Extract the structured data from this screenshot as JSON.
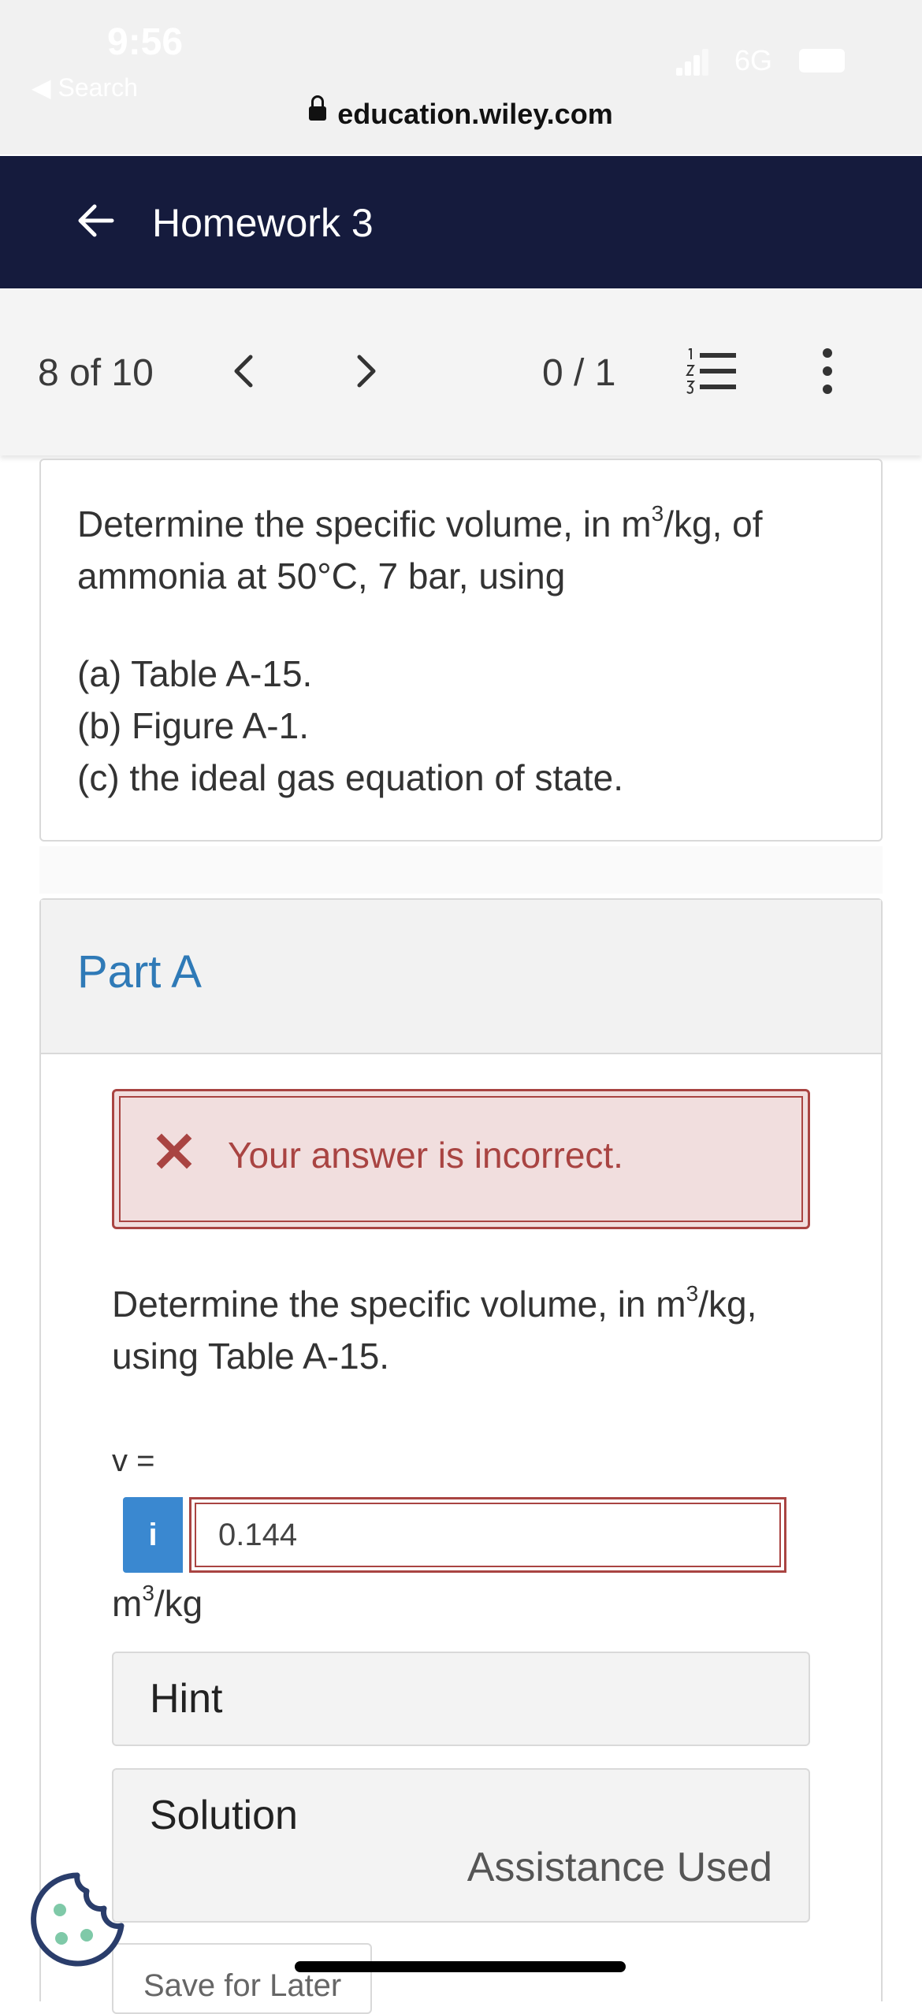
{
  "status_bar": {
    "time": "9:56",
    "back": "◀ Search",
    "network": "6G"
  },
  "browser": {
    "url": "education.wiley.com"
  },
  "header": {
    "title": "Homework 3"
  },
  "nav": {
    "position": "8 of 10",
    "score": "0 / 1"
  },
  "question": {
    "intro_1": "Determine the specific volume, in m",
    "intro_sup": "3",
    "intro_2": "/kg, of ammonia at 50°C, 7 bar, using",
    "parts": [
      "(a) Table A-15.",
      "(b) Figure A-1.",
      "(c) the ideal gas equation of state."
    ]
  },
  "part_a": {
    "title": "Part A",
    "alert": "Your answer is incorrect.",
    "prompt_1": "Determine the specific volume, in m",
    "prompt_sup": "3",
    "prompt_2": "/kg, using Table A-15.",
    "var_label": "v =",
    "info_label": "i",
    "answer_value": "0.144",
    "unit_base": "m",
    "unit_sup": "3",
    "unit_tail": "/kg",
    "hint_label": "Hint",
    "solution_label": "Solution",
    "assistance": "Assistance Used",
    "save_label": "Save for Later"
  },
  "colors": {
    "header_bg": "#151b3d",
    "part_title": "#2f7ab7",
    "error": "#a94442",
    "error_bg": "#f1dede",
    "info_button": "#3a88d0",
    "cookie": "#7fc9a8"
  },
  "icons": [
    "lock-icon",
    "back-arrow-icon",
    "chevron-left-icon",
    "chevron-right-icon",
    "numbered-list-icon",
    "more-vertical-icon",
    "close-x-icon",
    "info-icon",
    "cookie-icon"
  ]
}
